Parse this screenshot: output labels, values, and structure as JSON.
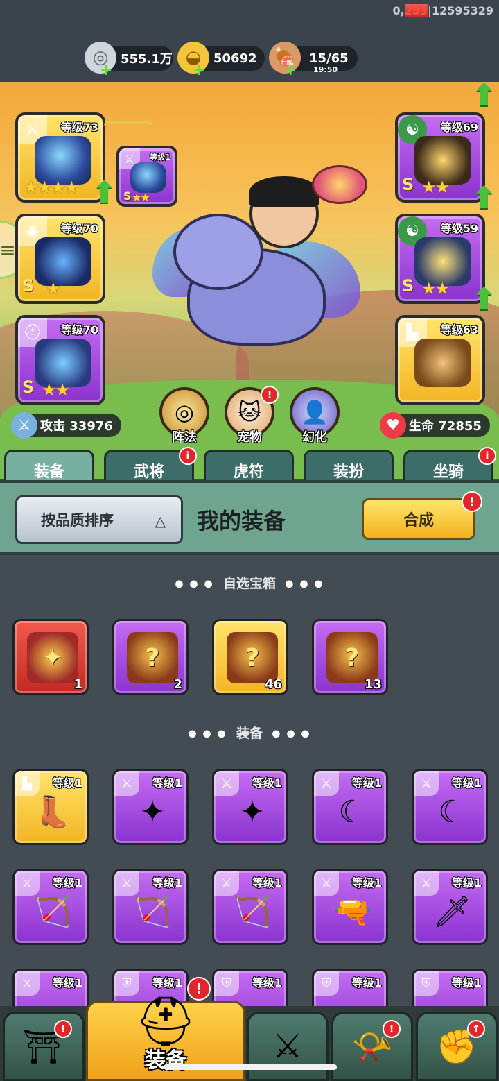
{
  "debug": {
    "part_a": "0,",
    "part_b": "233",
    "part_c": "|12595329"
  },
  "resources": [
    {
      "name": "silver-coin",
      "value": "555.1万"
    },
    {
      "name": "gold-ingot",
      "value": "50692"
    },
    {
      "name": "meat-stamina",
      "value": "15/65",
      "timer": "19:50"
    }
  ],
  "left_slots": [
    {
      "level": "等级73",
      "stars": 4,
      "color": "gold",
      "icon": "sword-icon"
    },
    {
      "level": "等级70",
      "stars": 1,
      "grade": "S",
      "color": "gold",
      "icon": "medal-icon"
    },
    {
      "level": "等级70",
      "stars": 2,
      "grade": "S",
      "color": "purple",
      "icon": "helmet-icon"
    }
  ],
  "linked_slot": {
    "level": "等级1",
    "stars": 2,
    "grade": "S",
    "color": "purple",
    "icon": "sword-icon"
  },
  "right_slots": [
    {
      "level": "等级69",
      "stars": 2,
      "grade": "S",
      "color": "purple",
      "icon": "yinyang-icon"
    },
    {
      "level": "等级59",
      "stars": 2,
      "grade": "S",
      "color": "purple",
      "icon": "yinyang-icon"
    },
    {
      "level": "等级63",
      "stars": 0,
      "color": "gold",
      "icon": "boot-icon"
    }
  ],
  "hero_buttons": [
    "阵法",
    "宠物",
    "幻化"
  ],
  "stats": {
    "attack": "攻击 33976",
    "hp": "生命 72855"
  },
  "tabs": [
    "装备",
    "武将",
    "虎符",
    "装扮",
    "坐骑"
  ],
  "panel": {
    "sort_label": "按品质排序",
    "title": "我的装备",
    "synth_label": "合成"
  },
  "sections": {
    "chests": "自选宝箱",
    "equipment": "装备"
  },
  "chests": [
    {
      "color": "red",
      "count": "1"
    },
    {
      "color": "purple",
      "count": "2"
    },
    {
      "color": "gold",
      "count": "46"
    },
    {
      "color": "purple",
      "count": "13"
    }
  ],
  "equipment_rows": [
    [
      {
        "color": "gold",
        "level": "等级1",
        "icon": "boot-icon",
        "glyph": "👢"
      },
      {
        "color": "purple",
        "level": "等级1",
        "icon": "shuriken-icon",
        "glyph": "✦"
      },
      {
        "color": "purple",
        "level": "等级1",
        "icon": "shuriken-icon",
        "glyph": "✦"
      },
      {
        "color": "purple",
        "level": "等级1",
        "icon": "curved-blade-icon",
        "glyph": "☾"
      },
      {
        "color": "purple",
        "level": "等级1",
        "icon": "curved-blade-icon",
        "glyph": "☾"
      }
    ],
    [
      {
        "color": "purple",
        "level": "等级1",
        "icon": "crossbow-icon",
        "glyph": "🏹"
      },
      {
        "color": "purple",
        "level": "等级1",
        "icon": "crossbow-icon",
        "glyph": "🏹"
      },
      {
        "color": "purple",
        "level": "等级1",
        "icon": "crossbow-icon",
        "glyph": "🏹"
      },
      {
        "color": "purple",
        "level": "等级1",
        "icon": "gun-icon",
        "glyph": "🔫"
      },
      {
        "color": "purple",
        "level": "等级1",
        "icon": "glaive-icon",
        "glyph": "🗡"
      }
    ],
    [
      {
        "color": "purple",
        "level": "等级1",
        "icon": "sword-icon",
        "glyph": ""
      },
      {
        "color": "purple",
        "level": "等级1",
        "icon": "armor-icon",
        "glyph": ""
      },
      {
        "color": "purple",
        "level": "等级1",
        "icon": "armor-icon",
        "glyph": ""
      },
      {
        "color": "purple",
        "level": "等级1",
        "icon": "armor-icon",
        "glyph": ""
      },
      {
        "color": "purple",
        "level": "等级1",
        "icon": "armor-icon",
        "glyph": ""
      }
    ]
  ],
  "bottom_nav": [
    {
      "icon": "shop-icon",
      "label": ""
    },
    {
      "icon": "helmet-icon",
      "label": "装备"
    },
    {
      "icon": "crossed-swords-icon",
      "label": ""
    },
    {
      "icon": "horn-icon",
      "label": ""
    },
    {
      "icon": "fist-upgrade-icon",
      "label": ""
    }
  ],
  "colors": {
    "gold": "#f2b524",
    "purple": "#8a33cf",
    "red": "#c22a22",
    "badge": "#e3262a"
  }
}
